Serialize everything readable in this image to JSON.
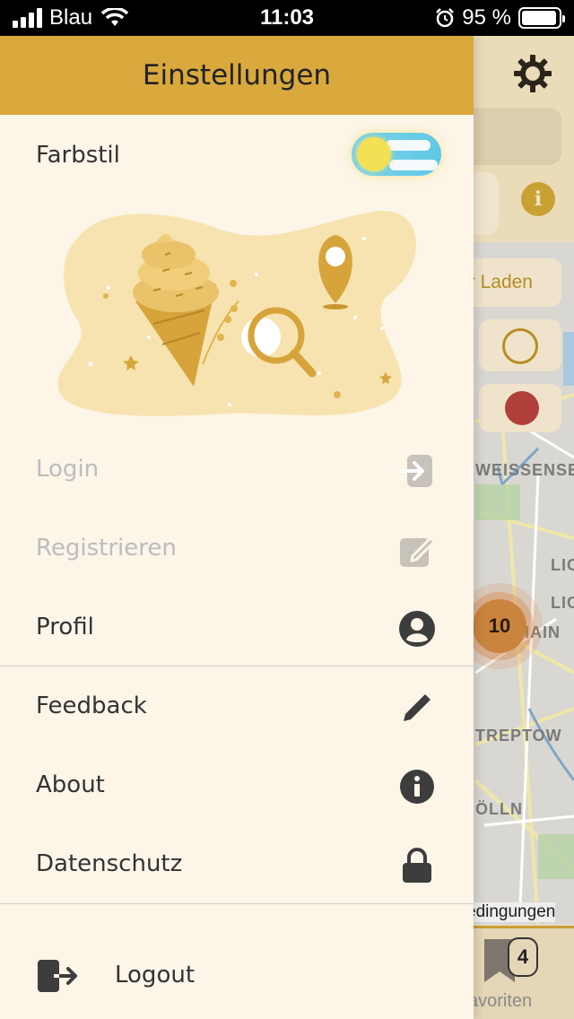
{
  "status_bar": {
    "carrier": "Blau",
    "time": "11:03",
    "battery": "95 %",
    "battery_level": 0.95
  },
  "drawer": {
    "title": "Einstellungen",
    "style_label": "Farbstil",
    "menu": [
      {
        "label": "Login",
        "icon": "login-icon",
        "enabled": false
      },
      {
        "label": "Registrieren",
        "icon": "register-edit-icon",
        "enabled": false
      },
      {
        "label": "Profil",
        "icon": "profile-icon",
        "enabled": true
      },
      {
        "label": "Feedback",
        "icon": "pencil-icon",
        "enabled": true
      },
      {
        "label": "About",
        "icon": "info-icon",
        "enabled": true
      },
      {
        "label": "Datenschutz",
        "icon": "lock-icon",
        "enabled": true
      }
    ],
    "logout_label": "Logout"
  },
  "background": {
    "load_label": "r Laden",
    "cluster_count": "10",
    "map_labels": [
      "WEISSENSEE",
      "LIC",
      "LIC",
      "ICHSHAIN",
      "TREPTOW",
      "ÖLLN"
    ],
    "terms_text": "edingungen",
    "favorites_count": "4",
    "favorites_label": "avoriten"
  },
  "colors": {
    "accent": "#d9a93e",
    "drawer_bg": "#fcf5e8",
    "text": "#333333",
    "disabled_text": "#bdbdbd"
  }
}
